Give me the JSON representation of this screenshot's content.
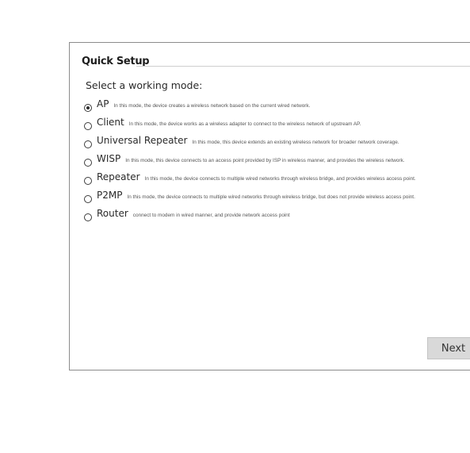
{
  "quick_setup": {
    "title": "Quick Setup",
    "prompt": "Select a working mode:",
    "next_label": "Next"
  },
  "modes": [
    {
      "name": "AP",
      "description": "In this mode, the device creates a wireless network based on the current wired network.",
      "selected": true
    },
    {
      "name": "Client",
      "description": "In this mode, the device works as a wireless adapter to connect to the wireless network of upstream AP.",
      "selected": false
    },
    {
      "name": "Universal Repeater",
      "description": "In this mode, this device extends an existing wireless network for broader network coverage.",
      "selected": false
    },
    {
      "name": "WISP",
      "description": "In this mode, this device connects to an access point provided by ISP in wireless manner, and provides the wireless network.",
      "selected": false
    },
    {
      "name": "Repeater",
      "description": "In this mode, the device connects to multiple wired networks through wireless bridge, and provides wireless access point.",
      "selected": false
    },
    {
      "name": "P2MP",
      "description": "In this mode, the device connects to multiple wired networks through wireless bridge, but does not provide wireless access point.",
      "selected": false
    },
    {
      "name": "Router",
      "description": "connect to modem in wired manner, and provide network access point",
      "selected": false
    }
  ]
}
